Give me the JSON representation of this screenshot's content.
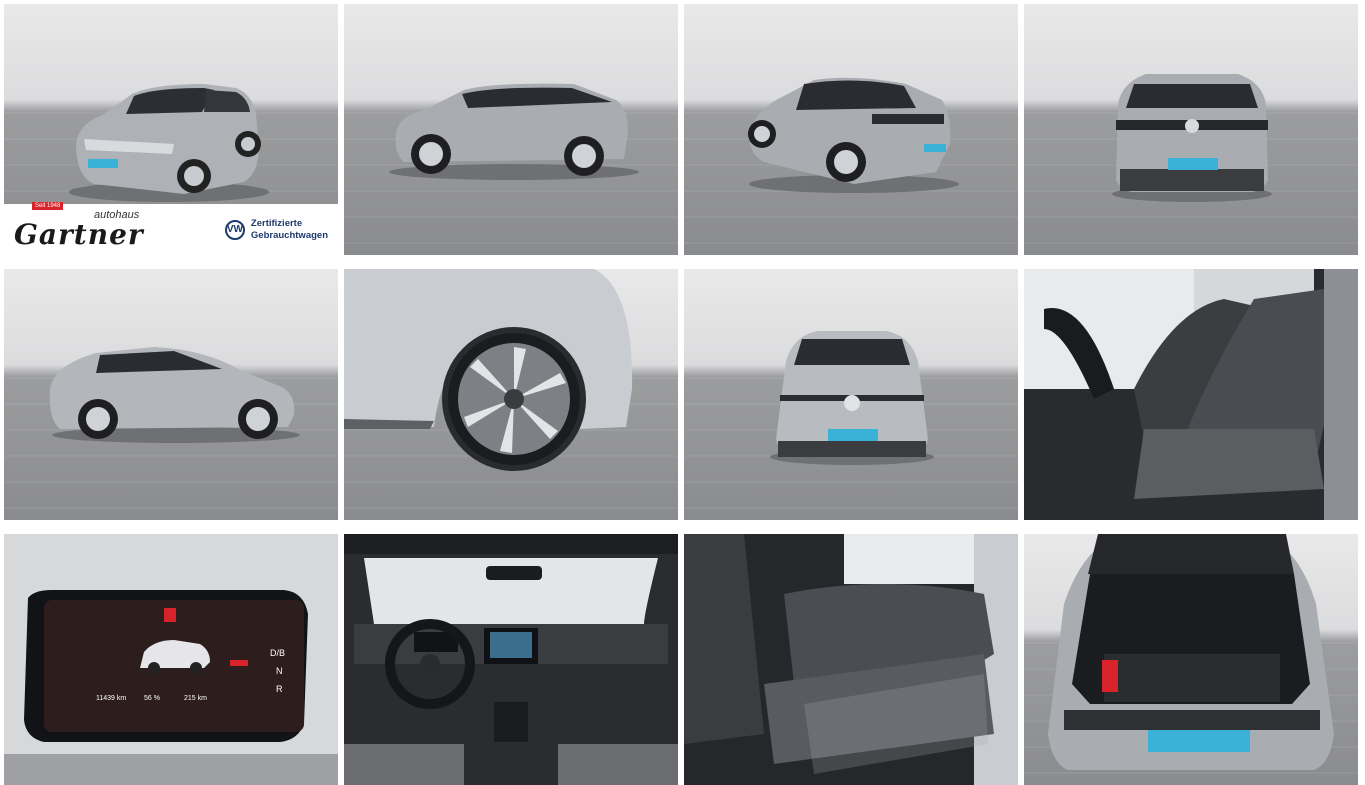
{
  "gallery": {
    "dealer": {
      "badge": "Seit 1948",
      "sub": "autohaus",
      "name": "Gartner",
      "certified_line1": "Zertifizierte",
      "certified_line2": "Gebrauchtwagen",
      "brand_icon": "vw-logo-icon"
    },
    "cluster": {
      "odometer": "11439 km",
      "battery": "56 %",
      "range": "215 km",
      "gears": [
        "D/B",
        "N",
        "R"
      ]
    },
    "photos": [
      {
        "view": "front-three-quarter"
      },
      {
        "view": "side-left"
      },
      {
        "view": "rear-three-quarter"
      },
      {
        "view": "rear"
      },
      {
        "view": "side-right"
      },
      {
        "view": "wheel-detail"
      },
      {
        "view": "front"
      },
      {
        "view": "front-seats"
      },
      {
        "view": "instrument-cluster"
      },
      {
        "view": "cockpit"
      },
      {
        "view": "rear-seats"
      },
      {
        "view": "trunk"
      }
    ],
    "colors": {
      "car_body": "#a9acb1",
      "car_roof": "#2a2c31",
      "plate": "#3ab1d6",
      "vw_blue": "#1d3b6d",
      "gartner_red": "#d8232a"
    }
  }
}
